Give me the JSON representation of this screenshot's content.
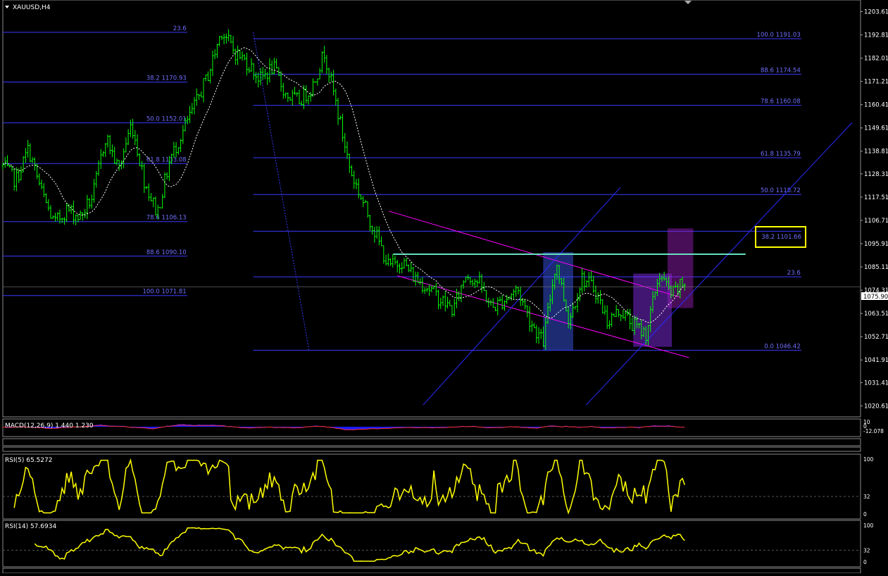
{
  "symbol_title": "XAUUSD,H4",
  "colors": {
    "background": "#000000",
    "candle": "#00ff00",
    "fib_lines": "#3a3aff",
    "fib_text": "#6f6fff",
    "channel": "#ff00ff",
    "ma": "#ffffff",
    "resistance": "#66e0c0",
    "rsi": "#ffff00",
    "highlight_box": "#ffff00",
    "macd_hist": "#1a1aff",
    "macd_signal": "#ff3030",
    "price_badge_bg": "#ffffff"
  },
  "chart_data": {
    "type": "candlestick",
    "symbol": "XAUUSD",
    "timeframe": "H4",
    "ylim": [
      1015.5,
      1209
    ],
    "y_ticks": [
      "1203.61",
      "1192.81",
      "1182.01",
      "1171.21",
      "1160.41",
      "1149.61",
      "1138.81",
      "1128.31",
      "1117.51",
      "1106.71",
      "1095.91",
      "1085.11",
      "1074.31",
      "1063.51",
      "1052.71",
      "1041.91",
      "1031.41",
      "1020.61"
    ],
    "current_price": "1075.90",
    "path": [
      1132,
      1125,
      1140,
      1120,
      1105,
      1112,
      1108,
      1118,
      1146,
      1130,
      1152,
      1125,
      1110,
      1135,
      1148,
      1161,
      1175,
      1195,
      1185,
      1180,
      1172,
      1178,
      1165,
      1162,
      1168,
      1185,
      1158,
      1130,
      1115,
      1100,
      1085,
      1088,
      1080,
      1076,
      1070,
      1065,
      1082,
      1078,
      1066,
      1070,
      1075,
      1060,
      1050,
      1088,
      1060,
      1080,
      1075,
      1060,
      1065,
      1058,
      1054,
      1082,
      1072,
      1078
    ],
    "candle_count": 300,
    "fib_left": {
      "levels": [
        "23.6",
        "38.2 1170.93",
        "50.0 1152.01",
        "61.8 1133.08",
        "78.6 1106.13",
        "88.6 1090.10",
        "100.0 1071.81"
      ],
      "prices": [
        1194,
        1170.93,
        1152.01,
        1133.08,
        1106.13,
        1090.1,
        1071.81
      ]
    },
    "fib_right": {
      "levels": [
        "100.0 1191.03",
        "88.6 1174.54",
        "78.6 1160.08",
        "61.8 1135.79",
        "50.0 1118.72",
        "38.2 1101.66",
        "23.6",
        "0.0 1046.42"
      ],
      "prices": [
        1191.03,
        1174.54,
        1160.08,
        1135.79,
        1118.72,
        1101.66,
        1080.5,
        1046.42
      ]
    },
    "highlighted_level": "38.2 1101.66",
    "resistance_price": 1091,
    "channel": {
      "upper": [
        [
          0.45,
          1111
        ],
        [
          0.79,
          1071
        ]
      ],
      "lower": [
        [
          0.46,
          1081
        ],
        [
          0.8,
          1043
        ]
      ]
    },
    "ray_lines": [
      [
        [
          0.49,
          1021
        ],
        [
          0.72,
          1122
        ]
      ],
      [
        [
          0.68,
          1021
        ],
        [
          0.99,
          1152
        ]
      ]
    ],
    "zones": [
      {
        "x0": 0.63,
        "x1": 0.665,
        "y0": 1046.4,
        "y1": 1092,
        "color": "#4060ff"
      },
      {
        "x0": 0.735,
        "x1": 0.78,
        "y0": 1048,
        "y1": 1082,
        "color": "#9030ff"
      },
      {
        "x0": 0.775,
        "x1": 0.805,
        "y0": 1066,
        "y1": 1103,
        "color": "#a020c0"
      }
    ],
    "macd": {
      "label": "MACD(12,26,9) 1.440 1.230",
      "scale_labels": [
        "10",
        "0",
        "-12.078"
      ]
    },
    "rsi5": {
      "label": "RSI(5) 65.5272",
      "levels": [
        "100",
        "32",
        "0"
      ]
    },
    "rsi14": {
      "label": "RSI(14) 57.6934",
      "levels": [
        "100",
        "32",
        "0"
      ]
    }
  }
}
